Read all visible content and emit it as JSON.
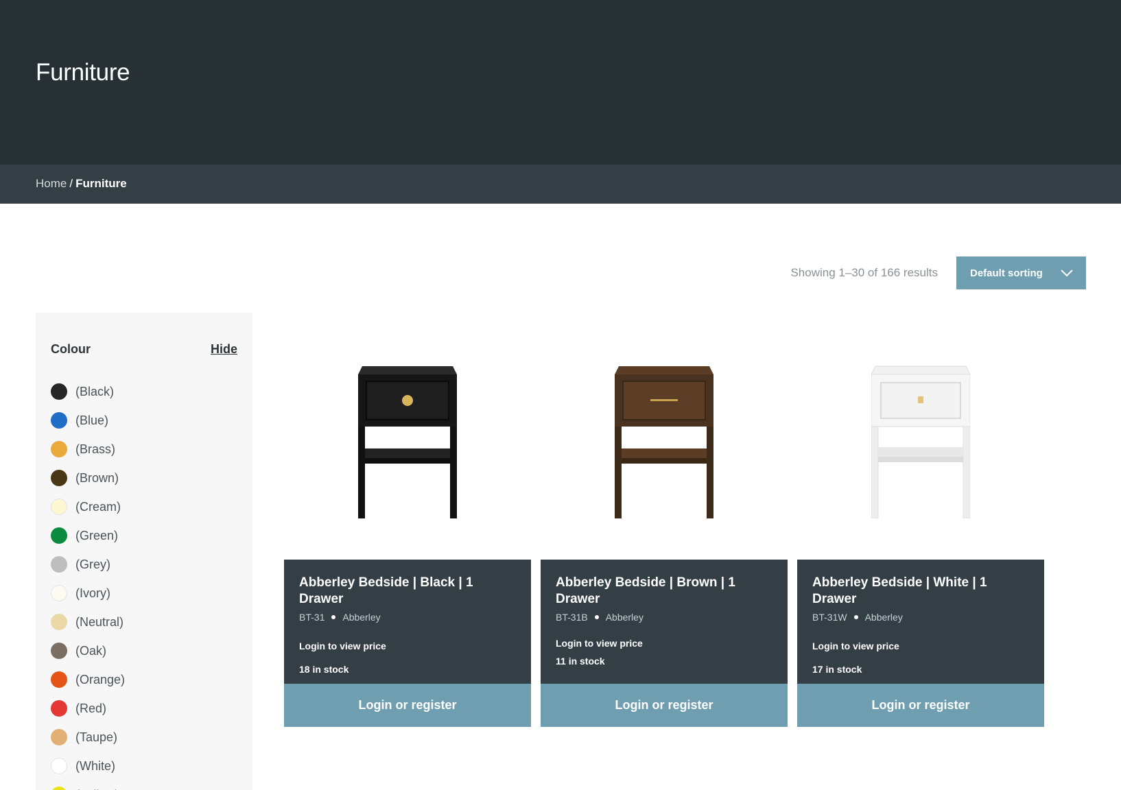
{
  "header": {
    "title": "Furniture"
  },
  "breadcrumb": {
    "home": "Home",
    "separator": "/",
    "current": "Furniture"
  },
  "toolbar": {
    "result_count": "Showing 1–30 of 166 results",
    "sort_selected": "Default sorting"
  },
  "sidebar": {
    "filter_title": "Colour",
    "hide_label": "Hide",
    "colors": [
      {
        "label": "(Black)",
        "hex": "#262626"
      },
      {
        "label": "(Blue)",
        "hex": "#1f6fc6"
      },
      {
        "label": "(Brass)",
        "hex": "#e9a93b"
      },
      {
        "label": "(Brown)",
        "hex": "#4a3815"
      },
      {
        "label": "(Cream)",
        "hex": "#fdf8d2"
      },
      {
        "label": "(Green)",
        "hex": "#0c8a3d"
      },
      {
        "label": "(Grey)",
        "hex": "#bdbdbd"
      },
      {
        "label": "(Ivory)",
        "hex": "#fcfbf1"
      },
      {
        "label": "(Neutral)",
        "hex": "#ead8a6"
      },
      {
        "label": "(Oak)",
        "hex": "#7a6f62"
      },
      {
        "label": "(Orange)",
        "hex": "#e55417"
      },
      {
        "label": "(Red)",
        "hex": "#e53834"
      },
      {
        "label": "(Taupe)",
        "hex": "#e2b072"
      },
      {
        "label": "(White)",
        "hex": "#ffffff"
      },
      {
        "label": "(Yellow)",
        "hex": "#eee21c"
      }
    ]
  },
  "products": [
    {
      "name": "Abberley Bedside | Black | 1 Drawer",
      "sku": "BT-31",
      "brand": "Abberley",
      "price": "Login to view price",
      "stock": "18 in stock",
      "cta": "Login or register",
      "finish": "black"
    },
    {
      "name": "Abberley Bedside | Brown | 1 Drawer",
      "sku": "BT-31B",
      "brand": "Abberley",
      "price": "Login to view price",
      "stock": "11 in stock",
      "cta": "Login or register",
      "finish": "brown"
    },
    {
      "name": "Abberley Bedside | White | 1 Drawer",
      "sku": "BT-31W",
      "brand": "Abberley",
      "price": "Login to view price",
      "stock": "17 in stock",
      "cta": "Login or register",
      "finish": "white"
    }
  ],
  "colors": {
    "hero_bg": "#263035",
    "crumb_bg": "#343f45",
    "card_bg": "#343f45",
    "accent": "#6f9eb0"
  }
}
